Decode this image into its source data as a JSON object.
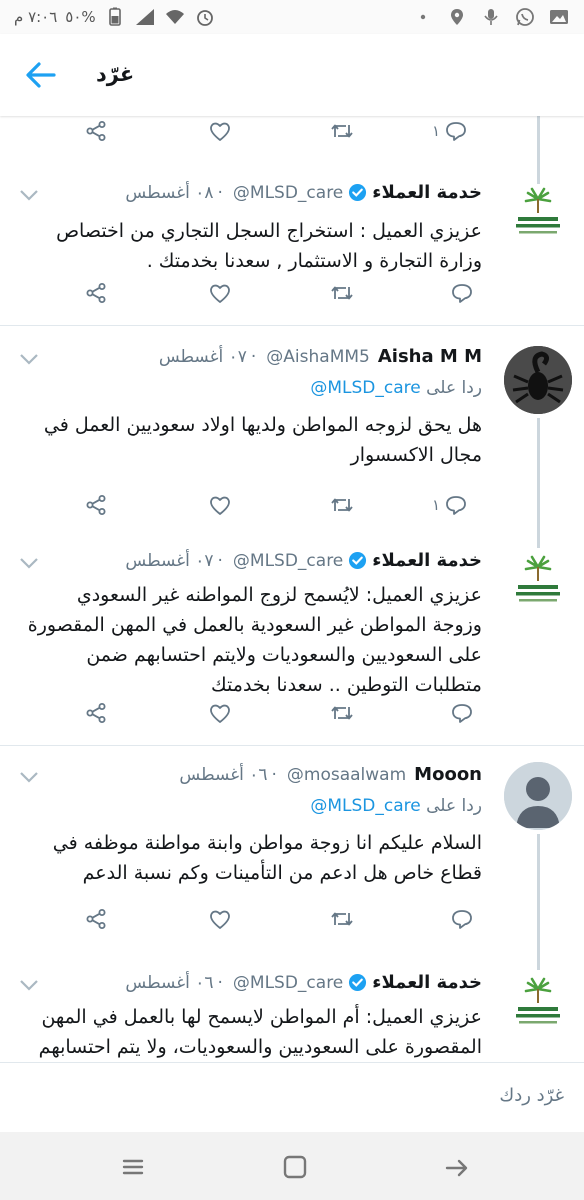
{
  "status_bar": {
    "time": "٧:٠٦ م",
    "battery": "٥٠%"
  },
  "header": {
    "title": "غرّد"
  },
  "colors": {
    "accent": "#1da1f2",
    "text": "#14171a",
    "muted": "#657786",
    "divider": "#e1e8ed"
  },
  "tweets": [
    {
      "actions": {
        "reply_count": "١"
      }
    },
    {
      "name": "خدمة العملاء",
      "handle": "@MLSD_care",
      "time": "٠٨ أغسطس",
      "body": "عزيزي العميل : استخراج السجل التجاري من اختصاص وزارة التجارة و الاستثمار , سعدنا بخدمتك ."
    },
    {
      "name": "Aisha M M",
      "handle": "@AishaMM5",
      "time": "٠٧ أغسطس",
      "reply_prefix": "ردا على",
      "reply_to": "@MLSD_care",
      "body": "هل يحق لزوجه المواطن ولديها اولاد سعوديين العمل في مجال الاكسسوار",
      "actions": {
        "reply_count": "١"
      }
    },
    {
      "name": "خدمة العملاء",
      "handle": "@MLSD_care",
      "time": "٠٧ أغسطس",
      "body": "عزيزي العميل: لايُسمح لزوج المواطنه غير السعودي وزوجة المواطن غير السعودية بالعمل في المهن المقصورة على السعوديين والسعوديات ولايتم احتسابهم ضمن متطلبات التوطين .. سعدنا بخدمتك"
    },
    {
      "name": "Mooon",
      "handle": "@mosaalwam",
      "time": "٠٦ أغسطس",
      "reply_prefix": "ردا على",
      "reply_to": "@MLSD_care",
      "body": "السلام عليكم انا زوجة مواطن وابنة مواطنة موظفه في قطاع خاص هل ادعم من التأمينات وكم نسبة الدعم"
    },
    {
      "name": "خدمة العملاء",
      "handle": "@MLSD_care",
      "time": "٠٦ أغسطس",
      "body": "عزيزي العميل: أم المواطن لايسمح لها بالعمل في المهن المقصورة على السعوديين والسعوديات، ولا يتم احتسابهم ضمن متطلبات التوطين .. سعدنا بخدمتك"
    }
  ],
  "composer": {
    "placeholder": "غرّد ردك"
  },
  "icons": {
    "back": "arrow-left-icon",
    "verified": "verified-badge-icon",
    "reply": "reply-icon",
    "retweet": "retweet-icon",
    "like": "heart-icon",
    "share": "share-icon",
    "more": "chevron-down-icon"
  }
}
